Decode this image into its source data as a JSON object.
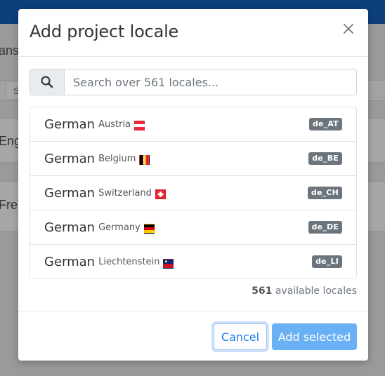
{
  "background": {
    "row1_text": "Eng",
    "row2_text": "Fren",
    "header_fragment": "ans",
    "small_fragment": "S"
  },
  "modal": {
    "title": "Add project locale",
    "search": {
      "placeholder": "Search over 561 locales..."
    },
    "locales": [
      {
        "language": "German",
        "region": "Austria",
        "code": "de_AT",
        "flag": "austria-flag"
      },
      {
        "language": "German",
        "region": "Belgium",
        "code": "de_BE",
        "flag": "belgium-flag"
      },
      {
        "language": "German",
        "region": "Switzerland",
        "code": "de_CH",
        "flag": "switzerland-flag"
      },
      {
        "language": "German",
        "region": "Germany",
        "code": "de_DE",
        "flag": "germany-flag"
      },
      {
        "language": "German",
        "region": "Liechtenstein",
        "code": "de_LI",
        "flag": "liechtenstein-flag"
      }
    ],
    "count_number": "561",
    "count_label": "available locales",
    "cancel_label": "Cancel",
    "add_label": "Add selected"
  },
  "colors": {
    "primary": "#1f7ae6",
    "primary_disabled": "#6ab0f5",
    "badge": "#6c757d"
  }
}
